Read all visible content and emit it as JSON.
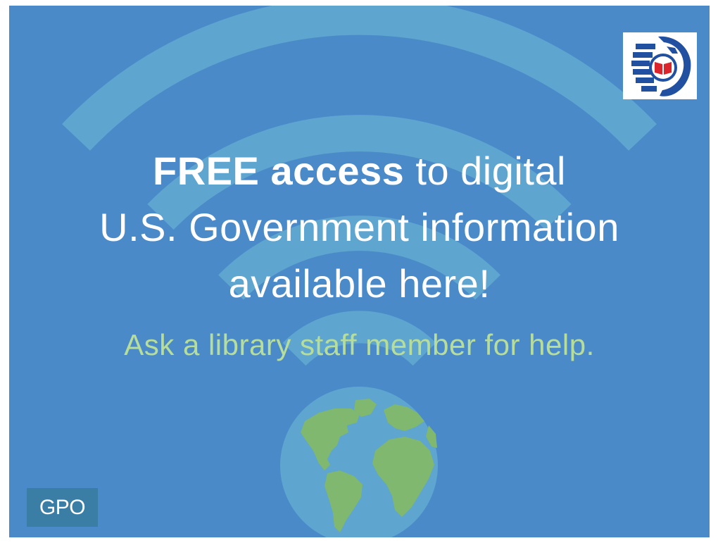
{
  "headline": {
    "line1_bold_1": "FREE",
    "line1_bold_2": "access",
    "line1_rest": "to digital",
    "line2": "U.S. Government information",
    "line3": "available here!"
  },
  "subline": "Ask a library staff member for help.",
  "logos": {
    "publisher_text": "GPO",
    "emblem_icon": "fdlp-eagle-book-icon"
  },
  "colors": {
    "background": "#4a8ac9",
    "wifi_arcs": "#5ea5cf",
    "globe_ocean": "#5ea5cf",
    "globe_land": "#7fb86e",
    "subline_text": "#b7dd9a",
    "gpo_box": "#3a7ea6",
    "emblem_blue": "#2150a0",
    "emblem_red": "#d9252b"
  },
  "icons": [
    "wifi-signal-icon",
    "globe-icon",
    "fdlp-eagle-book-icon"
  ]
}
